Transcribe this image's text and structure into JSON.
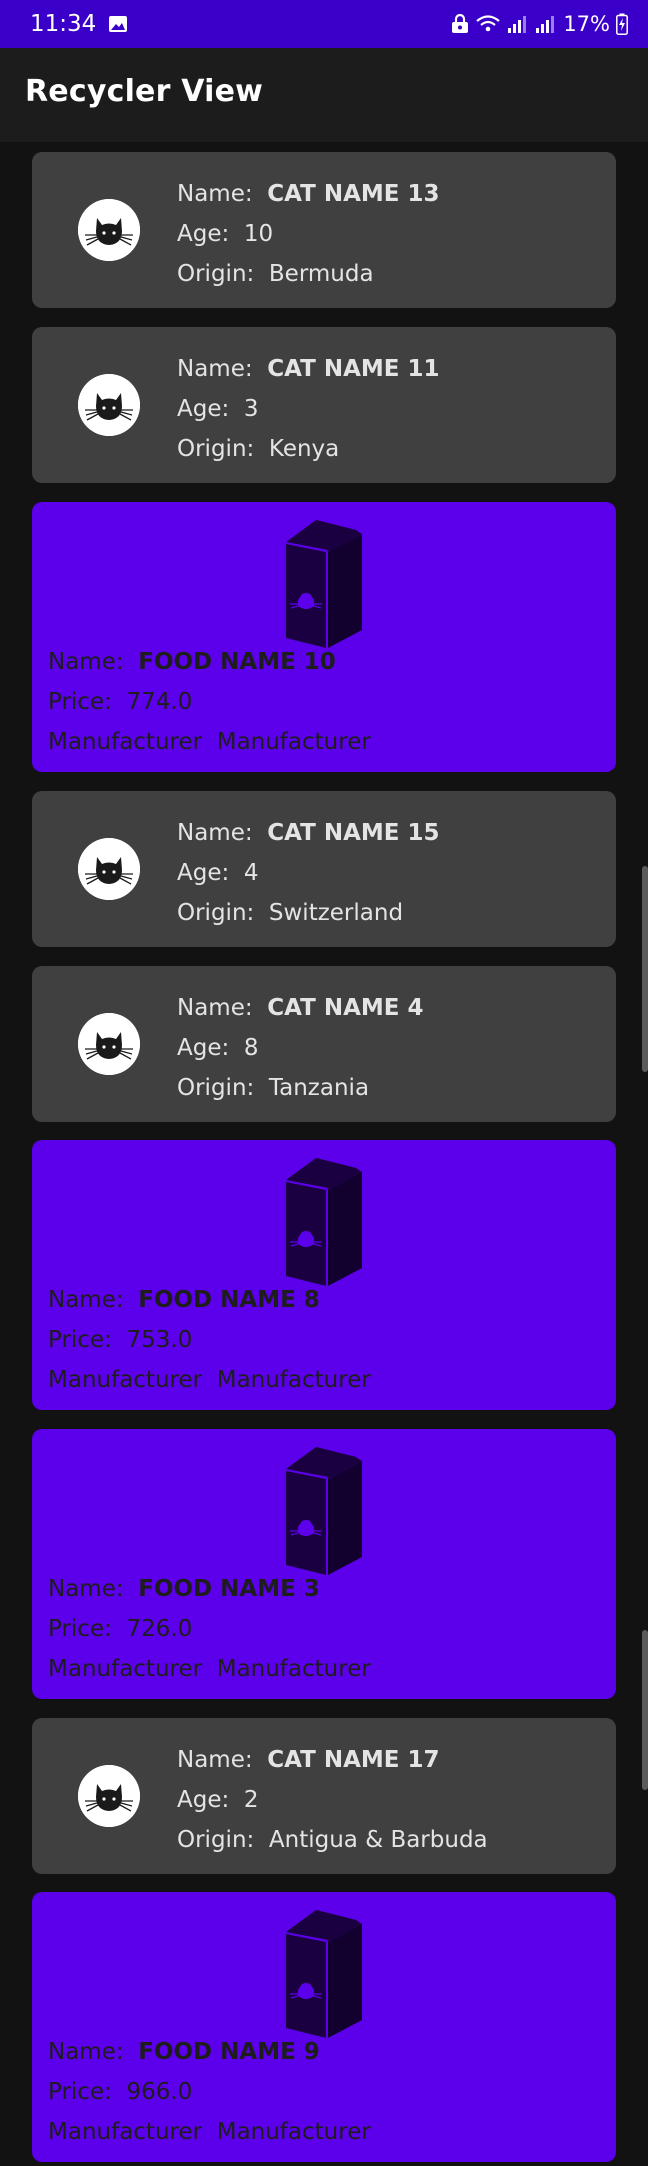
{
  "status": {
    "time": "11:34",
    "battery": "17%"
  },
  "app": {
    "title": "Recycler View"
  },
  "items": [
    {
      "type": "cat",
      "name_label": "Name:",
      "name": "CAT NAME 13",
      "age_label": "Age:",
      "age": "10",
      "origin_label": "Origin:",
      "origin": "Bermuda"
    },
    {
      "type": "cat",
      "name_label": "Name:",
      "name": "CAT NAME 11",
      "age_label": "Age:",
      "age": "3",
      "origin_label": "Origin:",
      "origin": "Kenya"
    },
    {
      "type": "food",
      "name_label": "Name:",
      "name": "FOOD NAME 10",
      "price_label": "Price:",
      "price": "774.0",
      "manufacturer_label": "Manufacturer",
      "manufacturer": "Manufacturer"
    },
    {
      "type": "cat",
      "name_label": "Name:",
      "name": "CAT NAME 15",
      "age_label": "Age:",
      "age": "4",
      "origin_label": "Origin:",
      "origin": "Switzerland"
    },
    {
      "type": "cat",
      "name_label": "Name:",
      "name": "CAT NAME 4",
      "age_label": "Age:",
      "age": "8",
      "origin_label": "Origin:",
      "origin": "Tanzania"
    },
    {
      "type": "food",
      "name_label": "Name:",
      "name": "FOOD NAME 8",
      "price_label": "Price:",
      "price": "753.0",
      "manufacturer_label": "Manufacturer",
      "manufacturer": "Manufacturer"
    },
    {
      "type": "food",
      "name_label": "Name:",
      "name": "FOOD NAME 3",
      "price_label": "Price:",
      "price": "726.0",
      "manufacturer_label": "Manufacturer",
      "manufacturer": "Manufacturer"
    },
    {
      "type": "cat",
      "name_label": "Name:",
      "name": "CAT NAME 17",
      "age_label": "Age:",
      "age": "2",
      "origin_label": "Origin:",
      "origin": "Antigua & Barbuda"
    },
    {
      "type": "food",
      "name_label": "Name:",
      "name": "FOOD NAME 9",
      "price_label": "Price:",
      "price": "966.0",
      "manufacturer_label": "Manufacturer",
      "manufacturer": "Manufacturer"
    }
  ],
  "colors": {
    "status_bar": "#3A00C9",
    "cat_card": "#404040",
    "food_card": "#5C00EB",
    "background": "#121212"
  },
  "icons": {
    "cat_avatar": "cat-face-icon",
    "food": "food-bag-icon"
  }
}
